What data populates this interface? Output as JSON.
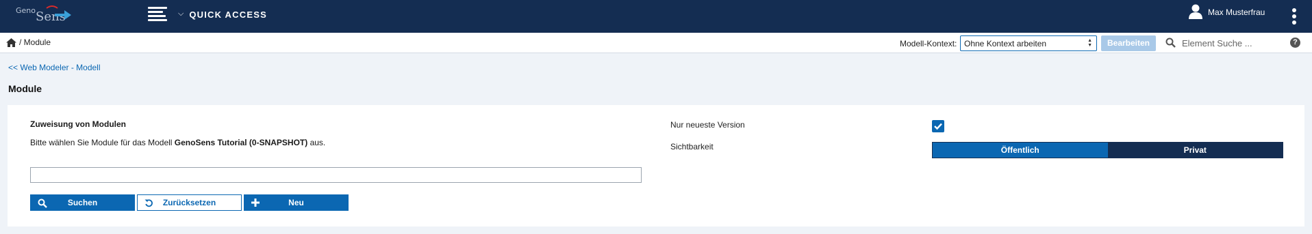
{
  "header": {
    "logo_top": "Geno",
    "logo_bottom": "Sens",
    "quick_access_label": "QUICK ACCESS",
    "user_name": "Max Musterfrau"
  },
  "subbar": {
    "breadcrumb": "/ Module",
    "context_label": "Modell-Kontext:",
    "context_value": "Ohne Kontext arbeiten",
    "edit_label": "Bearbeiten",
    "search_placeholder": "Element Suche ...",
    "help_label": "?"
  },
  "page": {
    "back_link": "<< Web Modeler - Modell",
    "title": "Module"
  },
  "panel": {
    "title": "Zuweisung von Modulen",
    "desc_prefix": "Bitte wählen Sie Module für das Modell ",
    "desc_model": "GenoSens Tutorial (0-SNAPSHOT)",
    "desc_suffix": " aus.",
    "search_value": "",
    "buttons": {
      "search": "Suchen",
      "reset": "Zurücksetzen",
      "new": "Neu"
    },
    "latest_version_label": "Nur neueste Version",
    "latest_version_checked": true,
    "visibility_label": "Sichtbarkeit",
    "visibility_options": [
      "Öffentlich",
      "Privat"
    ],
    "visibility_selected": "Öffentlich"
  },
  "colors": {
    "header_bg": "#142d52",
    "primary": "#0b67b2",
    "page_bg": "#eff3f8",
    "disabled_button": "#a9c9e8"
  },
  "icons": [
    "logo-swoosh-icon",
    "hamburger-icon",
    "chevron-down-icon",
    "user-icon",
    "kebab-icon",
    "home-icon",
    "select-arrows-icon",
    "search-icon",
    "help-icon",
    "check-icon",
    "undo-icon",
    "plus-icon"
  ]
}
